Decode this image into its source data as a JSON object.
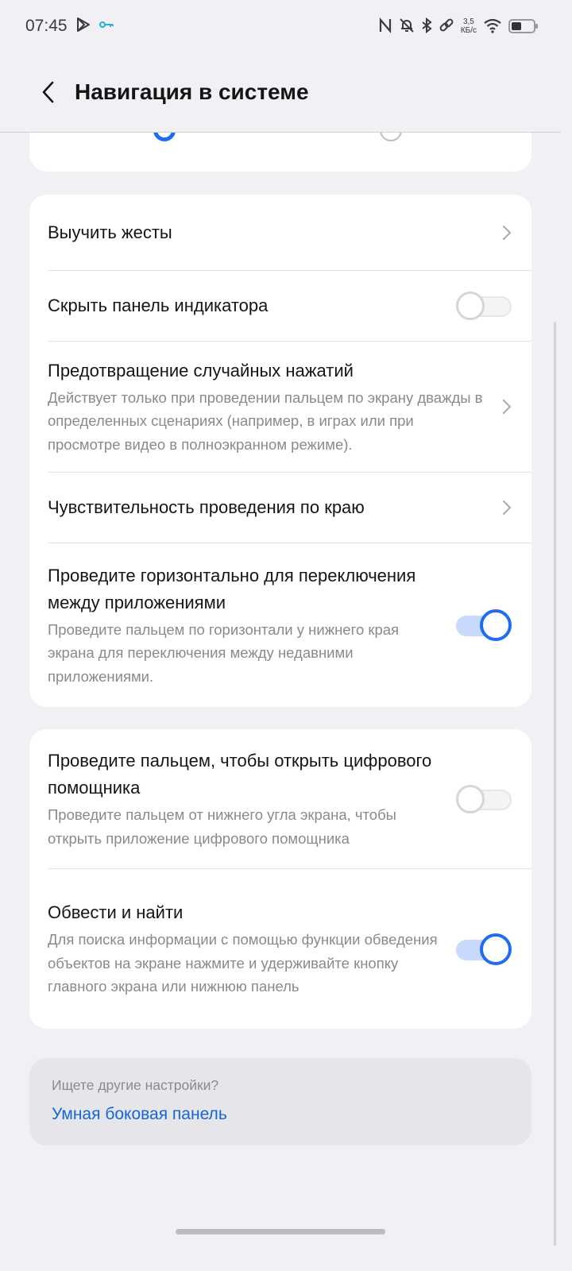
{
  "status_bar": {
    "time": "07:45",
    "speed_value": "3,5",
    "speed_unit": "КБ/с",
    "icons": [
      "play-store-icon",
      "key-icon",
      "nfc-icon",
      "mute-icon",
      "bluetooth-icon",
      "link-icon",
      "wifi-icon",
      "battery-icon"
    ]
  },
  "header": {
    "title": "Навигация в системе"
  },
  "gesture_group": {
    "items": [
      {
        "title": "Выучить жесты",
        "control": "chevron"
      },
      {
        "title": "Скрыть панель индикатора",
        "control": "toggle",
        "enabled": false
      },
      {
        "title": "Предотвращение случайных нажатий",
        "subtitle": "Действует только при проведении пальцем по экрану дважды в определенных сценариях (например, в играх или при просмотре видео в полноэкранном режиме).",
        "control": "chevron"
      },
      {
        "title": "Чувствительность проведения по краю",
        "control": "chevron"
      },
      {
        "title": "Проведите горизонтально для переключения между приложениями",
        "subtitle": "Проведите пальцем по горизонтали у нижнего края экрана для переключения между недавними приложениями.",
        "control": "toggle",
        "enabled": true
      }
    ]
  },
  "assistant_group": {
    "items": [
      {
        "title": "Проведите пальцем, чтобы открыть цифрового помощника",
        "subtitle": "Проведите пальцем от нижнего угла экрана, чтобы открыть приложение цифрового помощника",
        "control": "toggle",
        "enabled": false
      },
      {
        "title": "Обвести и найти",
        "subtitle": "Для поиска информации с помощью функции обведения объектов на экране нажмите и удерживайте кнопку главного экрана или нижнюю панель",
        "control": "toggle",
        "enabled": true
      }
    ]
  },
  "hint": {
    "question": "Ищете другие настройки?",
    "link": "Умная боковая панель"
  },
  "colors": {
    "accent": "#1e6cf0",
    "link": "#1467d4",
    "background": "#f1f0f5"
  }
}
